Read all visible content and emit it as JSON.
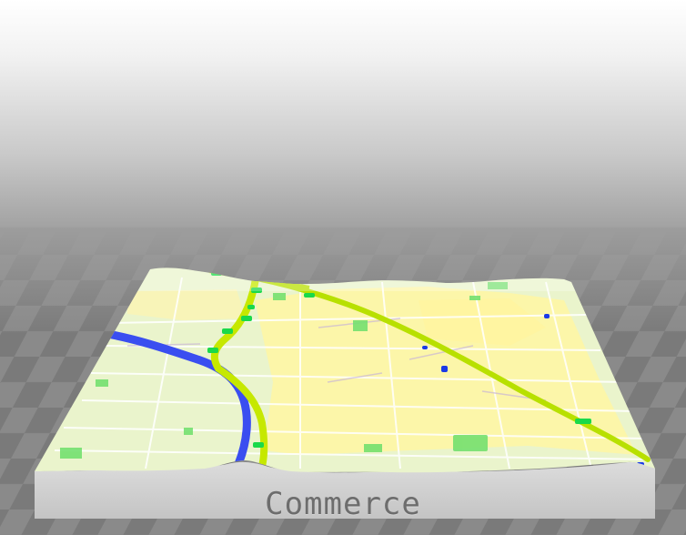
{
  "map": {
    "label": "Commerce",
    "colors": {
      "background_top": "#ffffff",
      "floor": "#7f7f7f",
      "base_side": "#d2d2d2",
      "map_land": "#eaf5c8",
      "city_area": "#fdf6a8",
      "freeway": "#b9e000",
      "river": "#3a4ee8",
      "park": "#70e070"
    }
  }
}
